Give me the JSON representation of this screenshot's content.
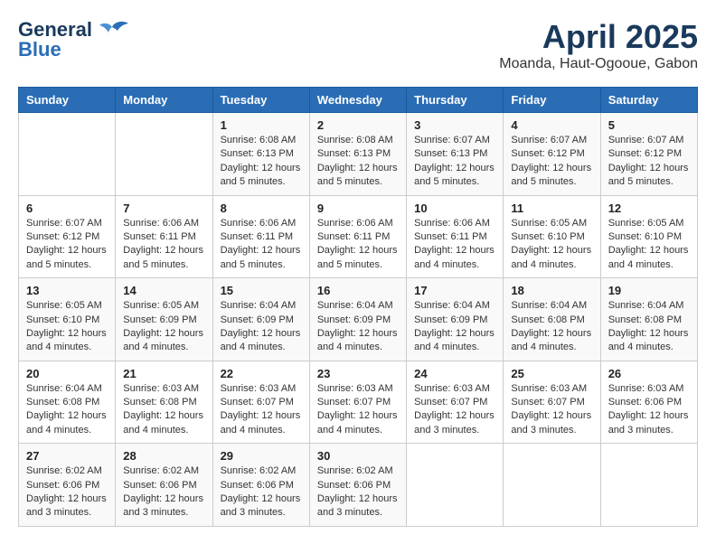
{
  "logo": {
    "line1": "General",
    "line2": "Blue"
  },
  "title": "April 2025",
  "subtitle": "Moanda, Haut-Ogooue, Gabon",
  "days_of_week": [
    "Sunday",
    "Monday",
    "Tuesday",
    "Wednesday",
    "Thursday",
    "Friday",
    "Saturday"
  ],
  "weeks": [
    [
      {
        "day": "",
        "info": ""
      },
      {
        "day": "",
        "info": ""
      },
      {
        "day": "1",
        "info": "Sunrise: 6:08 AM\nSunset: 6:13 PM\nDaylight: 12 hours and 5 minutes."
      },
      {
        "day": "2",
        "info": "Sunrise: 6:08 AM\nSunset: 6:13 PM\nDaylight: 12 hours and 5 minutes."
      },
      {
        "day": "3",
        "info": "Sunrise: 6:07 AM\nSunset: 6:13 PM\nDaylight: 12 hours and 5 minutes."
      },
      {
        "day": "4",
        "info": "Sunrise: 6:07 AM\nSunset: 6:12 PM\nDaylight: 12 hours and 5 minutes."
      },
      {
        "day": "5",
        "info": "Sunrise: 6:07 AM\nSunset: 6:12 PM\nDaylight: 12 hours and 5 minutes."
      }
    ],
    [
      {
        "day": "6",
        "info": "Sunrise: 6:07 AM\nSunset: 6:12 PM\nDaylight: 12 hours and 5 minutes."
      },
      {
        "day": "7",
        "info": "Sunrise: 6:06 AM\nSunset: 6:11 PM\nDaylight: 12 hours and 5 minutes."
      },
      {
        "day": "8",
        "info": "Sunrise: 6:06 AM\nSunset: 6:11 PM\nDaylight: 12 hours and 5 minutes."
      },
      {
        "day": "9",
        "info": "Sunrise: 6:06 AM\nSunset: 6:11 PM\nDaylight: 12 hours and 5 minutes."
      },
      {
        "day": "10",
        "info": "Sunrise: 6:06 AM\nSunset: 6:11 PM\nDaylight: 12 hours and 4 minutes."
      },
      {
        "day": "11",
        "info": "Sunrise: 6:05 AM\nSunset: 6:10 PM\nDaylight: 12 hours and 4 minutes."
      },
      {
        "day": "12",
        "info": "Sunrise: 6:05 AM\nSunset: 6:10 PM\nDaylight: 12 hours and 4 minutes."
      }
    ],
    [
      {
        "day": "13",
        "info": "Sunrise: 6:05 AM\nSunset: 6:10 PM\nDaylight: 12 hours and 4 minutes."
      },
      {
        "day": "14",
        "info": "Sunrise: 6:05 AM\nSunset: 6:09 PM\nDaylight: 12 hours and 4 minutes."
      },
      {
        "day": "15",
        "info": "Sunrise: 6:04 AM\nSunset: 6:09 PM\nDaylight: 12 hours and 4 minutes."
      },
      {
        "day": "16",
        "info": "Sunrise: 6:04 AM\nSunset: 6:09 PM\nDaylight: 12 hours and 4 minutes."
      },
      {
        "day": "17",
        "info": "Sunrise: 6:04 AM\nSunset: 6:09 PM\nDaylight: 12 hours and 4 minutes."
      },
      {
        "day": "18",
        "info": "Sunrise: 6:04 AM\nSunset: 6:08 PM\nDaylight: 12 hours and 4 minutes."
      },
      {
        "day": "19",
        "info": "Sunrise: 6:04 AM\nSunset: 6:08 PM\nDaylight: 12 hours and 4 minutes."
      }
    ],
    [
      {
        "day": "20",
        "info": "Sunrise: 6:04 AM\nSunset: 6:08 PM\nDaylight: 12 hours and 4 minutes."
      },
      {
        "day": "21",
        "info": "Sunrise: 6:03 AM\nSunset: 6:08 PM\nDaylight: 12 hours and 4 minutes."
      },
      {
        "day": "22",
        "info": "Sunrise: 6:03 AM\nSunset: 6:07 PM\nDaylight: 12 hours and 4 minutes."
      },
      {
        "day": "23",
        "info": "Sunrise: 6:03 AM\nSunset: 6:07 PM\nDaylight: 12 hours and 4 minutes."
      },
      {
        "day": "24",
        "info": "Sunrise: 6:03 AM\nSunset: 6:07 PM\nDaylight: 12 hours and 3 minutes."
      },
      {
        "day": "25",
        "info": "Sunrise: 6:03 AM\nSunset: 6:07 PM\nDaylight: 12 hours and 3 minutes."
      },
      {
        "day": "26",
        "info": "Sunrise: 6:03 AM\nSunset: 6:06 PM\nDaylight: 12 hours and 3 minutes."
      }
    ],
    [
      {
        "day": "27",
        "info": "Sunrise: 6:02 AM\nSunset: 6:06 PM\nDaylight: 12 hours and 3 minutes."
      },
      {
        "day": "28",
        "info": "Sunrise: 6:02 AM\nSunset: 6:06 PM\nDaylight: 12 hours and 3 minutes."
      },
      {
        "day": "29",
        "info": "Sunrise: 6:02 AM\nSunset: 6:06 PM\nDaylight: 12 hours and 3 minutes."
      },
      {
        "day": "30",
        "info": "Sunrise: 6:02 AM\nSunset: 6:06 PM\nDaylight: 12 hours and 3 minutes."
      },
      {
        "day": "",
        "info": ""
      },
      {
        "day": "",
        "info": ""
      },
      {
        "day": "",
        "info": ""
      }
    ]
  ]
}
